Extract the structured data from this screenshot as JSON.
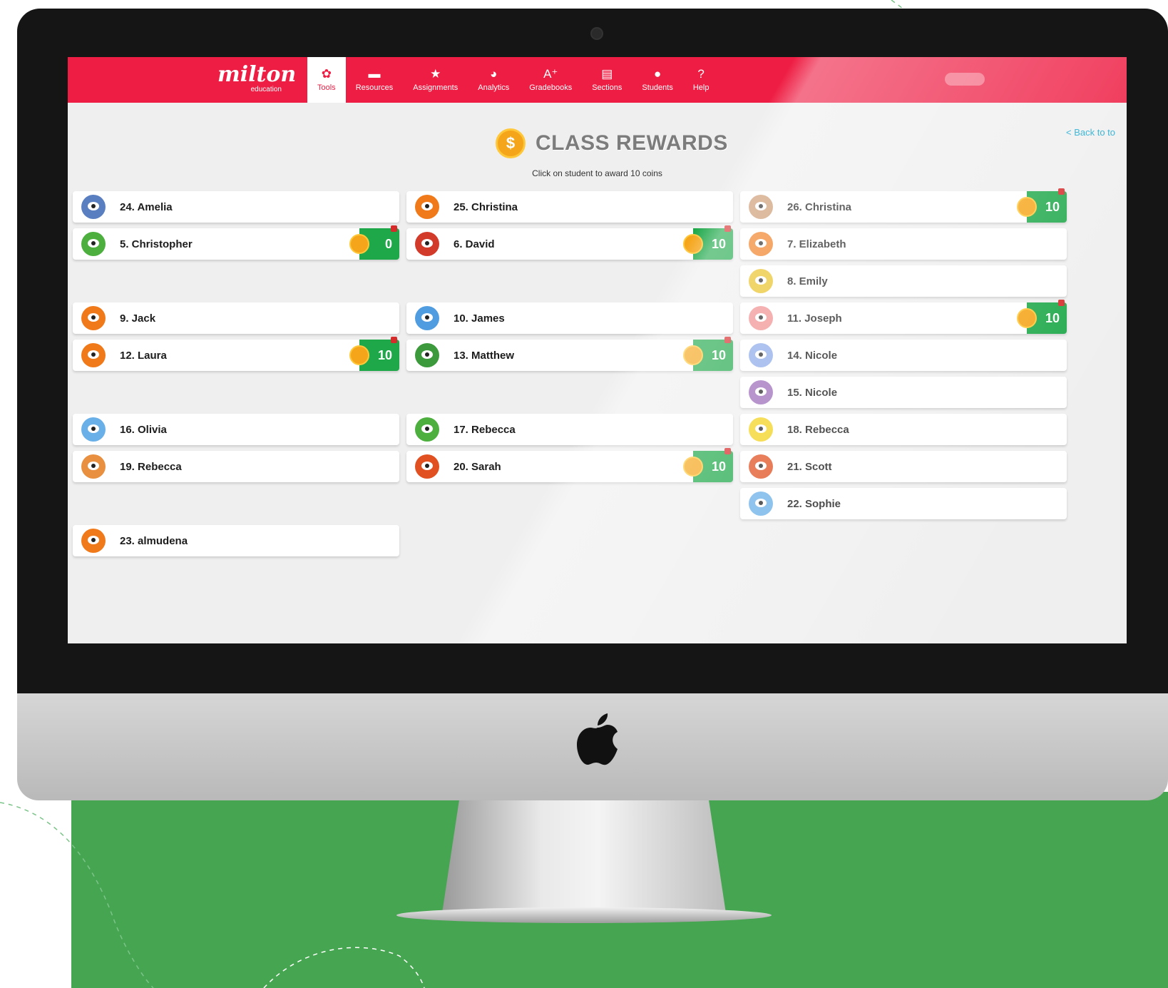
{
  "app": {
    "logo": "milton",
    "logo_sub": "education",
    "nav": [
      {
        "label": "Tools",
        "icon": "gear-icon",
        "glyph": "✿",
        "active": true
      },
      {
        "label": "Resources",
        "icon": "folder-icon",
        "glyph": "▬",
        "active": false
      },
      {
        "label": "Assignments",
        "icon": "star-icon",
        "glyph": "★",
        "active": false
      },
      {
        "label": "Analytics",
        "icon": "pie-chart-icon",
        "glyph": "◕",
        "active": false
      },
      {
        "label": "Gradebooks",
        "icon": "grade-icon",
        "glyph": "A⁺",
        "active": false
      },
      {
        "label": "Sections",
        "icon": "sections-icon",
        "glyph": "▤",
        "active": false
      },
      {
        "label": "Students",
        "icon": "user-icon",
        "glyph": "●",
        "active": false
      },
      {
        "label": "Help",
        "icon": "help-icon",
        "glyph": "?",
        "active": false
      }
    ],
    "back_link": "< Back to to",
    "title": "CLASS REWARDS",
    "title_coin": "$",
    "instruction": "Click on student to award 10 coins"
  },
  "students": [
    {
      "name": "24. Amelia",
      "col": 1,
      "row": 1,
      "avatar_color": "#5a7fc0",
      "coins": null
    },
    {
      "name": "25. Christina",
      "col": 2,
      "row": 1,
      "avatar_color": "#f07a1a",
      "coins": null
    },
    {
      "name": "26. Christina",
      "col": 3,
      "row": 1,
      "avatar_color": "#c9956a",
      "coins": "10"
    },
    {
      "name": "5. Christopher",
      "col": 1,
      "row": 2,
      "avatar_color": "#4caf3e",
      "coins": "0"
    },
    {
      "name": "6. David",
      "col": 2,
      "row": 2,
      "avatar_color": "#d23a2a",
      "coins": "10"
    },
    {
      "name": "7. Elizabeth",
      "col": 3,
      "row": 2,
      "avatar_color": "#f07a1a",
      "coins": null
    },
    {
      "name": "8. Emily",
      "col": 3,
      "row": 3,
      "avatar_color": "#e8c020",
      "coins": null
    },
    {
      "name": "9. Jack",
      "col": 1,
      "row": 4,
      "avatar_color": "#f07a1a",
      "coins": null
    },
    {
      "name": "10. James",
      "col": 2,
      "row": 4,
      "avatar_color": "#4f9de0",
      "coins": null
    },
    {
      "name": "11. Joseph",
      "col": 3,
      "row": 4,
      "avatar_color": "#f08c8c",
      "coins": "10"
    },
    {
      "name": "12. Laura",
      "col": 1,
      "row": 5,
      "avatar_color": "#f07a1a",
      "coins": "10"
    },
    {
      "name": "13. Matthew",
      "col": 2,
      "row": 5,
      "avatar_color": "#3c9a3c",
      "coins": "10"
    },
    {
      "name": "14. Nicole",
      "col": 3,
      "row": 5,
      "avatar_color": "#8aa8e8",
      "coins": null
    },
    {
      "name": "15. Nicole",
      "col": 3,
      "row": 6,
      "avatar_color": "#9a6ab8",
      "coins": null
    },
    {
      "name": "16. Olivia",
      "col": 1,
      "row": 7,
      "avatar_color": "#6ab0e8",
      "coins": null
    },
    {
      "name": "17. Rebecca",
      "col": 2,
      "row": 7,
      "avatar_color": "#4caf3e",
      "coins": null
    },
    {
      "name": "18. Rebecca",
      "col": 3,
      "row": 7,
      "avatar_color": "#f2d21a",
      "coins": null
    },
    {
      "name": "19. Rebecca",
      "col": 1,
      "row": 8,
      "avatar_color": "#e89040",
      "coins": null
    },
    {
      "name": "20. Sarah",
      "col": 2,
      "row": 8,
      "avatar_color": "#e05020",
      "coins": "10"
    },
    {
      "name": "21. Scott",
      "col": 3,
      "row": 8,
      "avatar_color": "#e05020",
      "coins": null
    },
    {
      "name": "22. Sophie",
      "col": 3,
      "row": 9,
      "avatar_color": "#6ab0e8",
      "coins": null
    },
    {
      "name": "23. almudena",
      "col": 1,
      "row": 10,
      "avatar_color": "#f07a1a",
      "coins": null
    }
  ],
  "colors": {
    "brand": "#ee1d43",
    "badge": "#1fa84a",
    "coin": "#f5a51a",
    "background": "#46a550"
  }
}
